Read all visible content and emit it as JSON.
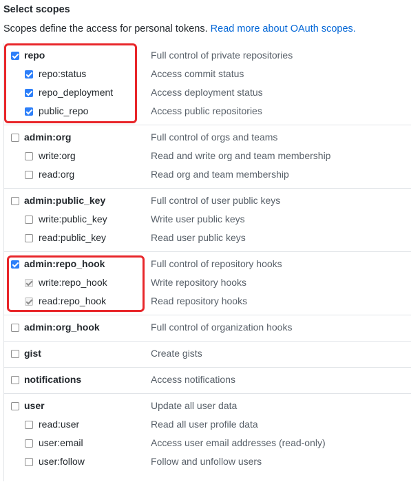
{
  "heading": "Select scopes",
  "description": "Scopes define the access for personal tokens.",
  "link_text": "Read more about OAuth scopes.",
  "highlight_color": "#e8262a",
  "checkbox_color": "#2d7ff9",
  "scope_groups": [
    {
      "name": "repo",
      "description": "Full control of private repositories",
      "checked": true,
      "children": [
        {
          "name": "repo:status",
          "description": "Access commit status",
          "checked": true
        },
        {
          "name": "repo_deployment",
          "description": "Access deployment status",
          "checked": true
        },
        {
          "name": "public_repo",
          "description": "Access public repositories",
          "checked": true
        }
      ]
    },
    {
      "name": "admin:org",
      "description": "Full control of orgs and teams",
      "checked": false,
      "children": [
        {
          "name": "write:org",
          "description": "Read and write org and team membership",
          "checked": false
        },
        {
          "name": "read:org",
          "description": "Read org and team membership",
          "checked": false
        }
      ]
    },
    {
      "name": "admin:public_key",
      "description": "Full control of user public keys",
      "checked": false,
      "children": [
        {
          "name": "write:public_key",
          "description": "Write user public keys",
          "checked": false
        },
        {
          "name": "read:public_key",
          "description": "Read user public keys",
          "checked": false
        }
      ]
    },
    {
      "name": "admin:repo_hook",
      "description": "Full control of repository hooks",
      "checked": true,
      "children": [
        {
          "name": "write:repo_hook",
          "description": "Write repository hooks",
          "checked": true,
          "disabled": true
        },
        {
          "name": "read:repo_hook",
          "description": "Read repository hooks",
          "checked": true,
          "disabled": true
        }
      ]
    },
    {
      "name": "admin:org_hook",
      "description": "Full control of organization hooks",
      "checked": false,
      "children": []
    },
    {
      "name": "gist",
      "description": "Create gists",
      "checked": false,
      "children": []
    },
    {
      "name": "notifications",
      "description": "Access notifications",
      "checked": false,
      "children": []
    },
    {
      "name": "user",
      "description": "Update all user data",
      "checked": false,
      "children": [
        {
          "name": "read:user",
          "description": "Read all user profile data",
          "checked": false
        },
        {
          "name": "user:email",
          "description": "Access user email addresses (read-only)",
          "checked": false
        },
        {
          "name": "user:follow",
          "description": "Follow and unfollow users",
          "checked": false
        }
      ]
    }
  ]
}
